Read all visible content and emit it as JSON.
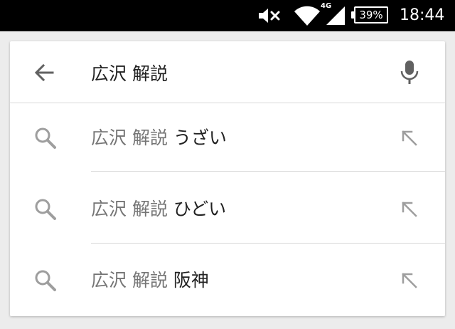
{
  "status_bar": {
    "time": "18:44",
    "battery": "39%",
    "network_type": "4G",
    "icons": [
      "volume-mute-icon",
      "wifi-icon",
      "cell-signal-icon",
      "battery-icon"
    ]
  },
  "search": {
    "query": "広沢 解説",
    "icons": {
      "back": "arrow-back-icon",
      "voice": "microphone-icon"
    }
  },
  "suggestions": [
    {
      "prefix": "広沢 解説",
      "suffix": "うざい",
      "icon": "search-icon",
      "action_icon": "arrow-up-left-icon"
    },
    {
      "prefix": "広沢 解説",
      "suffix": "ひどい",
      "icon": "search-icon",
      "action_icon": "arrow-up-left-icon"
    },
    {
      "prefix": "広沢 解説",
      "suffix": "阪神",
      "icon": "search-icon",
      "action_icon": "arrow-up-left-icon"
    }
  ],
  "colors": {
    "status_bar_bg": "#000000",
    "page_bg": "#ececec",
    "card_bg": "#ffffff",
    "primary_text": "#212121",
    "secondary_text": "#757575",
    "icon_gray": "#9e9e9e",
    "divider": "#d8d8d8"
  }
}
